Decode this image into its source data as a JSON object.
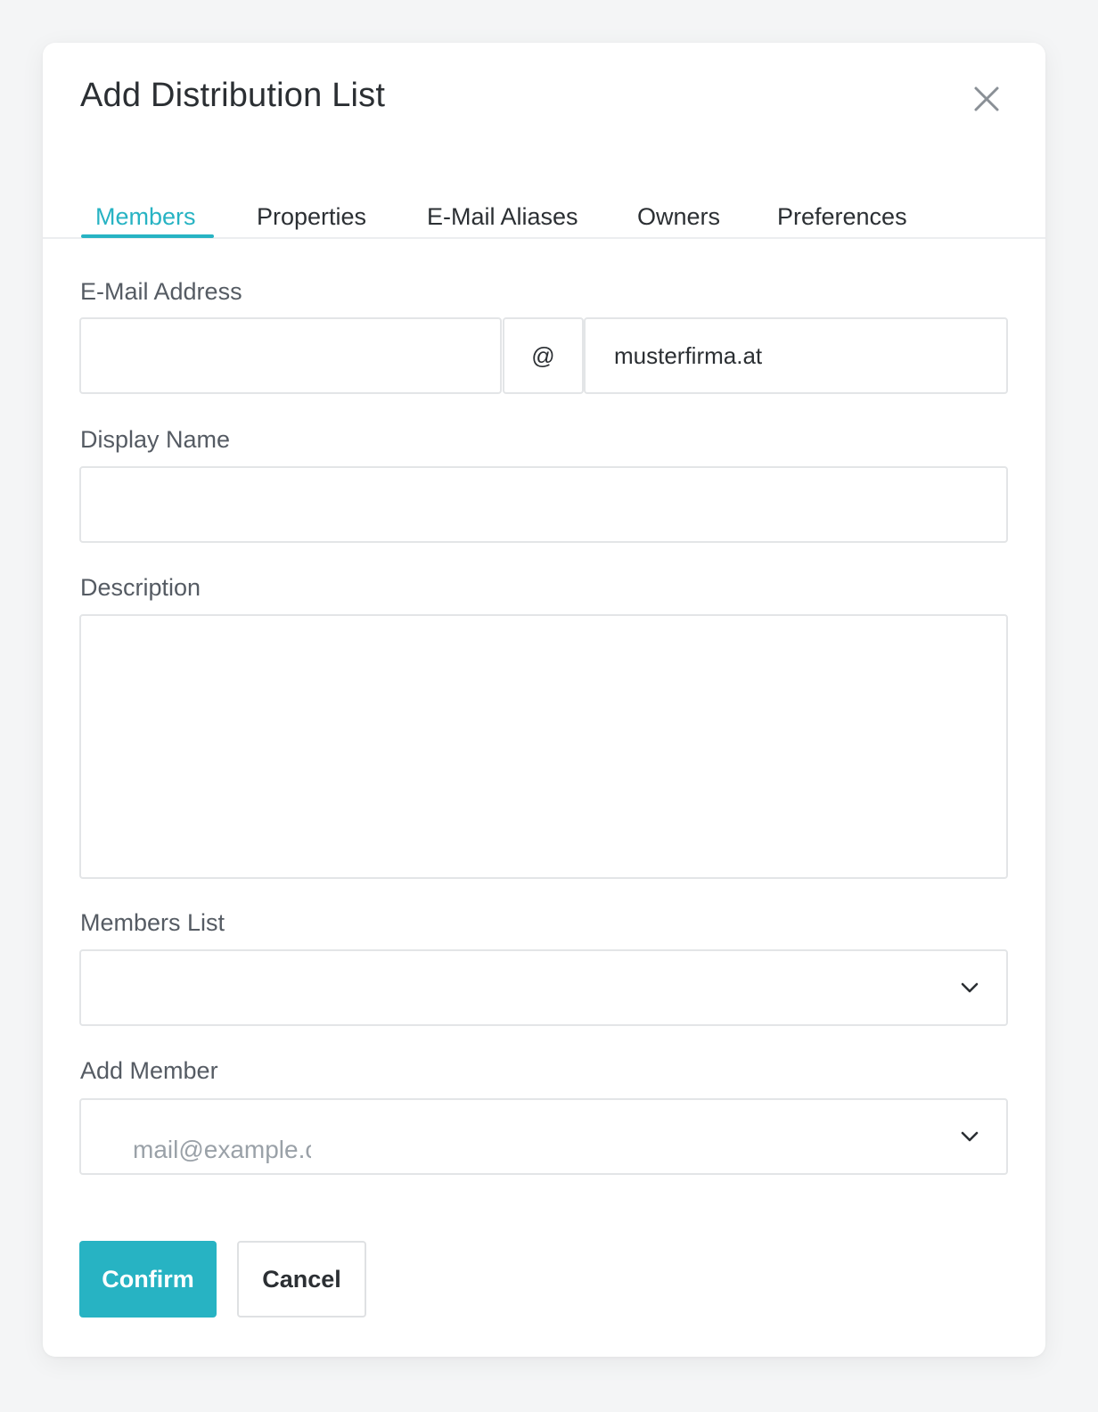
{
  "dialog": {
    "title": "Add Distribution List",
    "close_icon": "close-icon"
  },
  "tabs": [
    {
      "label": "Members",
      "active": true
    },
    {
      "label": "Properties",
      "active": false
    },
    {
      "label": "E-Mail Aliases",
      "active": false
    },
    {
      "label": "Owners",
      "active": false
    },
    {
      "label": "Preferences",
      "active": false
    }
  ],
  "form": {
    "email": {
      "label": "E-Mail Address",
      "local_value": "",
      "separator": "@",
      "domain": "musterfirma.at"
    },
    "display_name": {
      "label": "Display Name",
      "value": ""
    },
    "description": {
      "label": "Description",
      "value": ""
    },
    "members_list": {
      "label": "Members List",
      "value": ""
    },
    "add_member": {
      "label": "Add Member",
      "placeholder": "mail@example.c"
    }
  },
  "actions": {
    "confirm_label": "Confirm",
    "cancel_label": "Cancel"
  },
  "colors": {
    "accent": "#27b3c3",
    "text": "#2b2f33",
    "label": "#555b63",
    "border": "#e3e5e7"
  }
}
